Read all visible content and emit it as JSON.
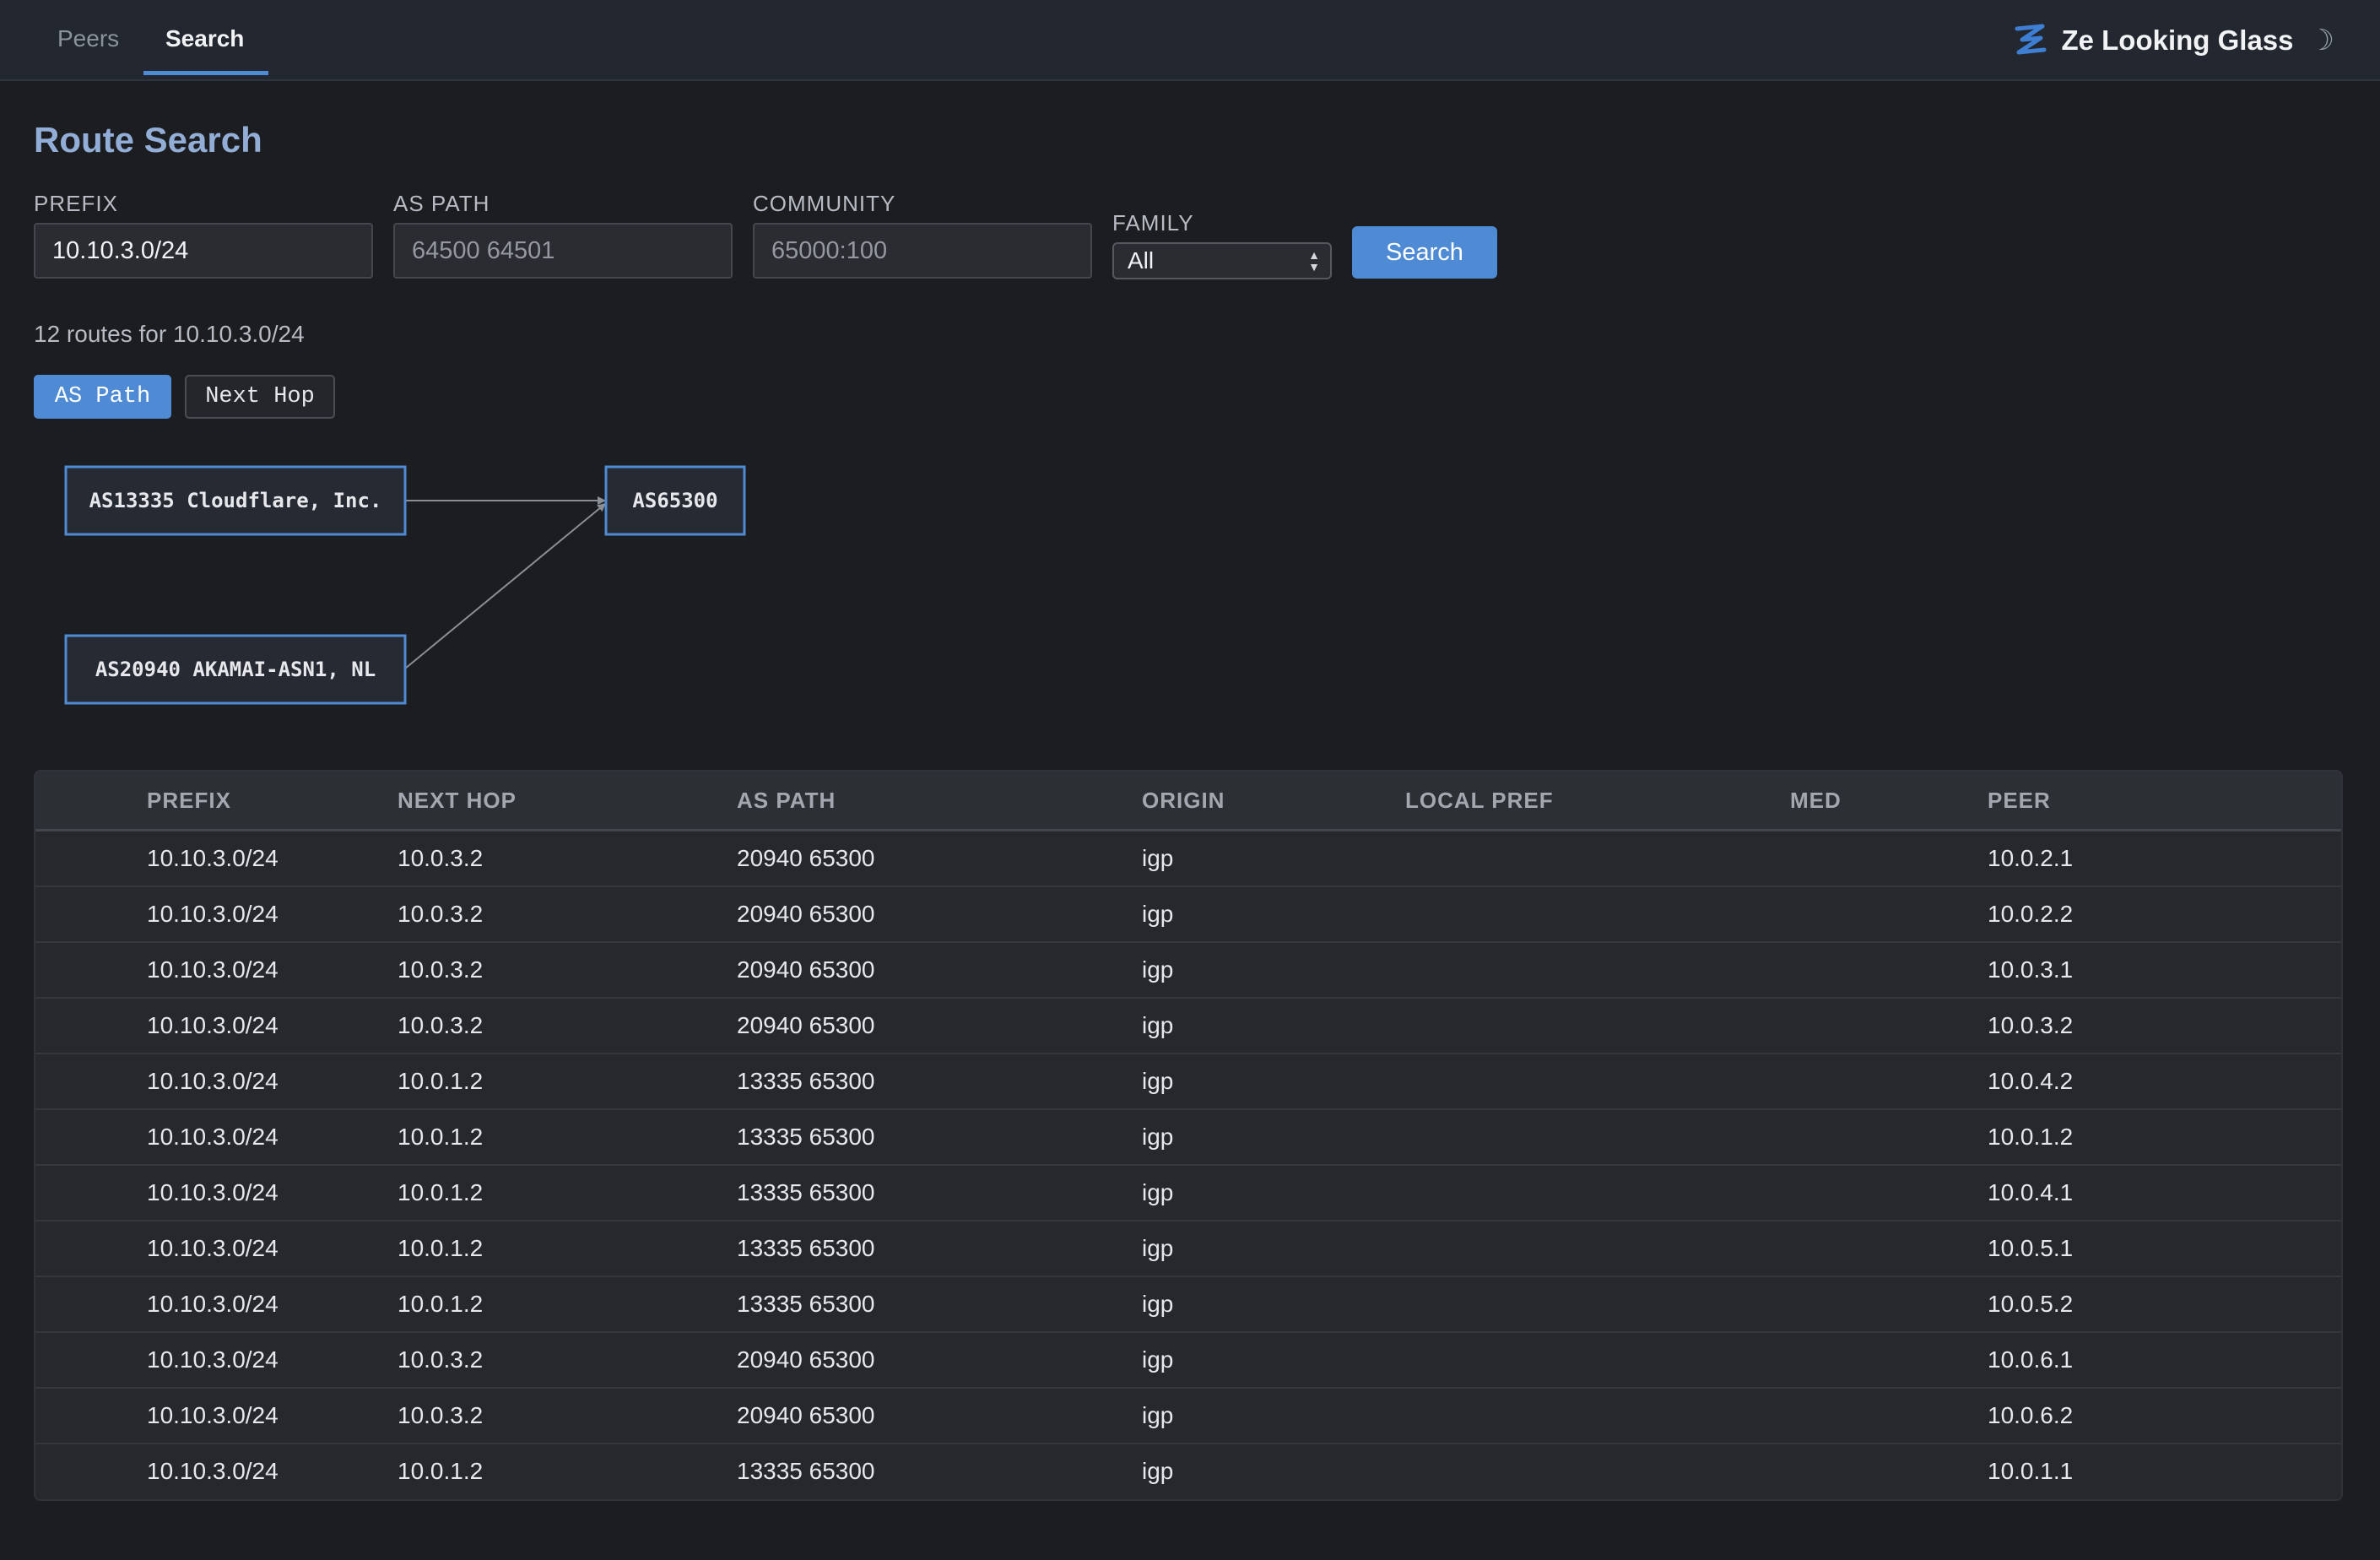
{
  "nav": {
    "tabs": [
      {
        "label": "Peers",
        "active": false
      },
      {
        "label": "Search",
        "active": true
      }
    ],
    "brand_title": "Ze Looking Glass",
    "theme_toggle": "☽",
    "accent_color": "#4f8ad4"
  },
  "page": {
    "title": "Route Search"
  },
  "form": {
    "prefix": {
      "label": "PREFIX",
      "value": "10.10.3.0/24",
      "placeholder": ""
    },
    "as_path": {
      "label": "AS PATH",
      "value": "",
      "placeholder": "64500 64501"
    },
    "community": {
      "label": "COMMUNITY",
      "value": "",
      "placeholder": "65000:100"
    },
    "family": {
      "label": "FAMILY",
      "selected": "All"
    },
    "search_button": "Search"
  },
  "results": {
    "summary": "12 routes for 10.10.3.0/24",
    "view_toggle": {
      "as_path": "AS Path",
      "next_hop": "Next Hop",
      "active": "as_path"
    },
    "graph": {
      "nodes": [
        "AS13335 Cloudflare, Inc.",
        "AS20940 AKAMAI-ASN1, NL",
        "AS65300"
      ],
      "edges": [
        {
          "from": "AS13335 Cloudflare, Inc.",
          "to": "AS65300"
        },
        {
          "from": "AS20940 AKAMAI-ASN1, NL",
          "to": "AS65300"
        }
      ]
    },
    "columns": [
      "PREFIX",
      "NEXT HOP",
      "AS PATH",
      "ORIGIN",
      "LOCAL PREF",
      "MED",
      "PEER"
    ],
    "rows": [
      [
        "10.10.3.0/24",
        "10.0.3.2",
        "20940 65300",
        "igp",
        "",
        "",
        "10.0.2.1"
      ],
      [
        "10.10.3.0/24",
        "10.0.3.2",
        "20940 65300",
        "igp",
        "",
        "",
        "10.0.2.2"
      ],
      [
        "10.10.3.0/24",
        "10.0.3.2",
        "20940 65300",
        "igp",
        "",
        "",
        "10.0.3.1"
      ],
      [
        "10.10.3.0/24",
        "10.0.3.2",
        "20940 65300",
        "igp",
        "",
        "",
        "10.0.3.2"
      ],
      [
        "10.10.3.0/24",
        "10.0.1.2",
        "13335 65300",
        "igp",
        "",
        "",
        "10.0.4.2"
      ],
      [
        "10.10.3.0/24",
        "10.0.1.2",
        "13335 65300",
        "igp",
        "",
        "",
        "10.0.1.2"
      ],
      [
        "10.10.3.0/24",
        "10.0.1.2",
        "13335 65300",
        "igp",
        "",
        "",
        "10.0.4.1"
      ],
      [
        "10.10.3.0/24",
        "10.0.1.2",
        "13335 65300",
        "igp",
        "",
        "",
        "10.0.5.1"
      ],
      [
        "10.10.3.0/24",
        "10.0.1.2",
        "13335 65300",
        "igp",
        "",
        "",
        "10.0.5.2"
      ],
      [
        "10.10.3.0/24",
        "10.0.3.2",
        "20940 65300",
        "igp",
        "",
        "",
        "10.0.6.1"
      ],
      [
        "10.10.3.0/24",
        "10.0.3.2",
        "20940 65300",
        "igp",
        "",
        "",
        "10.0.6.2"
      ],
      [
        "10.10.3.0/24",
        "10.0.1.2",
        "13335 65300",
        "igp",
        "",
        "",
        "10.0.1.1"
      ]
    ]
  }
}
